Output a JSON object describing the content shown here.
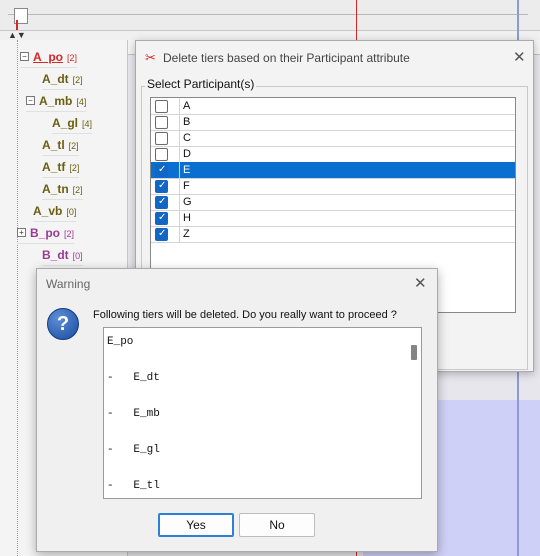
{
  "tree": {
    "toggle_expand": "+",
    "toggle_collapse": "−",
    "items": [
      {
        "label": "A_po",
        "count": "[2]",
        "color": "#d12828"
      },
      {
        "label": "A_dt",
        "count": "[2]",
        "color": "#6b5e12"
      },
      {
        "label": "A_mb",
        "count": "[4]",
        "color": "#6b5e12"
      },
      {
        "label": "A_gl",
        "count": "[4]",
        "color": "#6b5e12"
      },
      {
        "label": "A_tl",
        "count": "[2]",
        "color": "#6b5e12"
      },
      {
        "label": "A_tf",
        "count": "[2]",
        "color": "#6b5e12"
      },
      {
        "label": "A_tn",
        "count": "[2]",
        "color": "#6b5e12"
      },
      {
        "label": "A_vb",
        "count": "[0]",
        "color": "#6b5e12"
      },
      {
        "label": "B_po",
        "count": "[2]",
        "color": "#9b3a93"
      },
      {
        "label": "B_dt",
        "count": "[0]",
        "color": "#9b3a93"
      }
    ]
  },
  "back_dialog": {
    "title": "Delete tiers based on their Participant attribute",
    "close_glyph": "✕",
    "group_label": "Select Participant(s)",
    "check_glyph": "✓",
    "participants": [
      {
        "label": "A",
        "checked": false,
        "selected": false
      },
      {
        "label": "B",
        "checked": false,
        "selected": false
      },
      {
        "label": "C",
        "checked": false,
        "selected": false
      },
      {
        "label": "D",
        "checked": false,
        "selected": false
      },
      {
        "label": "E",
        "checked": true,
        "selected": true
      },
      {
        "label": "F",
        "checked": true,
        "selected": false
      },
      {
        "label": "G",
        "checked": true,
        "selected": false
      },
      {
        "label": "H",
        "checked": true,
        "selected": false
      },
      {
        "label": "Z",
        "checked": true,
        "selected": false
      }
    ]
  },
  "warning_dialog": {
    "title": "Warning",
    "close_glyph": "✕",
    "icon_glyph": "?",
    "message": "Following tiers will be deleted. Do you really want to proceed ?",
    "tier_lines": [
      "E_po",
      "-   E_dt",
      "-   E_mb",
      "-   E_gl",
      "-   E_tl"
    ],
    "yes_label": "Yes",
    "no_label": "No"
  },
  "colors": {
    "accent": "#0b6fcf",
    "checkbox": "#1266c4",
    "red_marker": "#d12828"
  }
}
